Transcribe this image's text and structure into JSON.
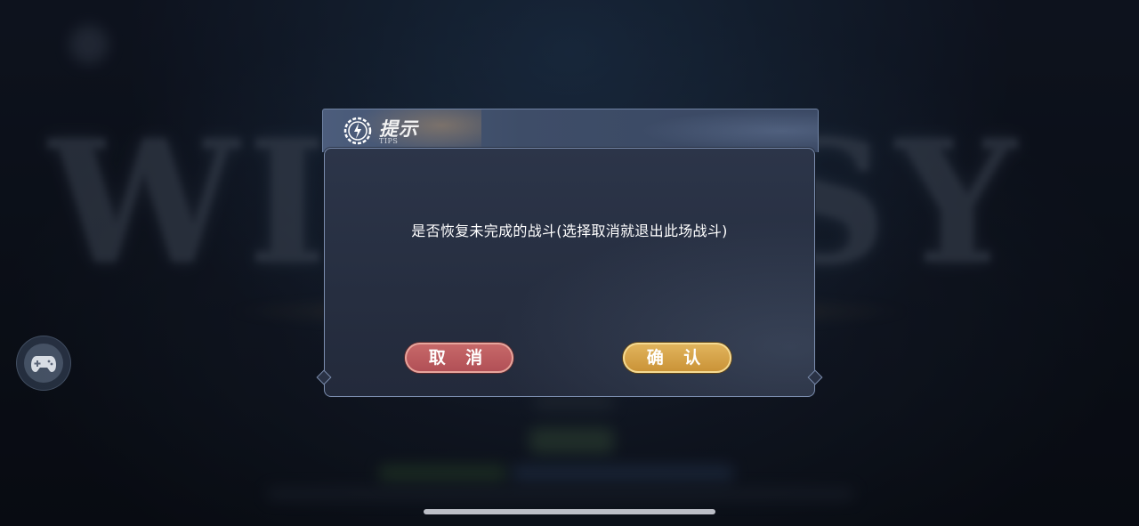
{
  "background": {
    "logo_text": "WINTASY"
  },
  "dialog": {
    "title": "提示",
    "title_sub": "TIPS",
    "message": "是否恢复未完成的战斗(选择取消就退出此场战斗)",
    "cancel_label": "取 消",
    "confirm_label": "确 认",
    "colors": {
      "cancel": "#b04e55",
      "confirm": "#c99135",
      "panel": "#262e40",
      "border": "#7b8dae"
    }
  },
  "icons": {
    "tip": "lightning-bolt-in-gear-icon",
    "gamepad": "gamepad-icon"
  }
}
